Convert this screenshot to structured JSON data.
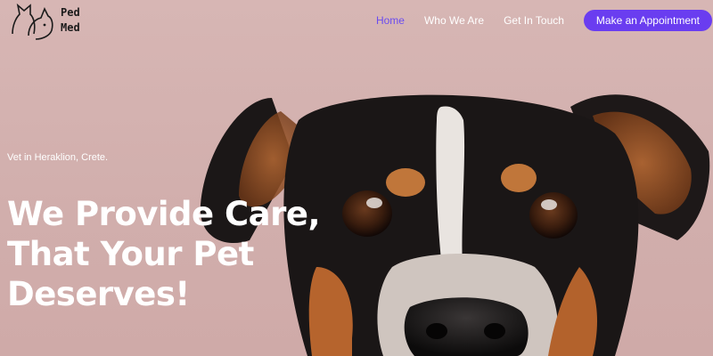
{
  "brand": {
    "line1": "Ped",
    "line2": "Med",
    "logo_icon": "cat-and-dog-outline-icon"
  },
  "nav": {
    "items": [
      {
        "label": "Home",
        "active": true
      },
      {
        "label": "Who We Are",
        "active": false
      },
      {
        "label": "Get In Touch",
        "active": false
      }
    ],
    "cta_label": "Make an Appointment"
  },
  "hero": {
    "eyebrow": "Vet in Heraklion, Crete.",
    "headline": [
      "We Provide Care,",
      "That Your Pet",
      "Deserves!"
    ],
    "image": "dog-face-photo"
  },
  "colors": {
    "accent": "#6a3df0",
    "active_link": "#6a4cf0",
    "background": "#d4b2b0",
    "text_light": "#ffffff"
  }
}
